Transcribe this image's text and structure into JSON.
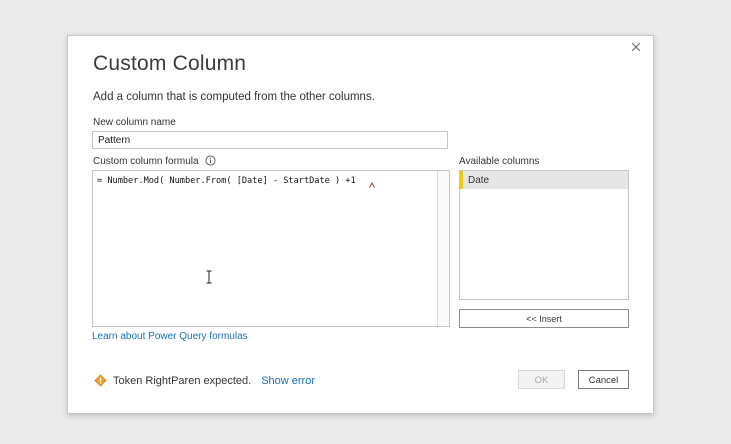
{
  "dialog": {
    "title": "Custom Column",
    "subtitle": "Add a column that is computed from the other columns.",
    "close_icon": "close-icon"
  },
  "new_column": {
    "label": "New column name",
    "value": "Pattern"
  },
  "formula": {
    "label": "Custom column formula",
    "info_icon": "info-icon",
    "value": "= Number.Mod( Number.From( [Date] - StartDate ) +1"
  },
  "available_columns": {
    "label": "Available columns",
    "items": [
      "Date"
    ],
    "selected": "Date",
    "accent_color": "#f2c811"
  },
  "insert_button": {
    "label": "<< Insert"
  },
  "learn_link": {
    "label": "Learn about Power Query formulas"
  },
  "status": {
    "icon": "warning-icon",
    "message": "Token RightParen expected.",
    "show_error_label": "Show error",
    "error_color": "#e05555"
  },
  "footer": {
    "ok_label": "OK",
    "cancel_label": "Cancel"
  }
}
